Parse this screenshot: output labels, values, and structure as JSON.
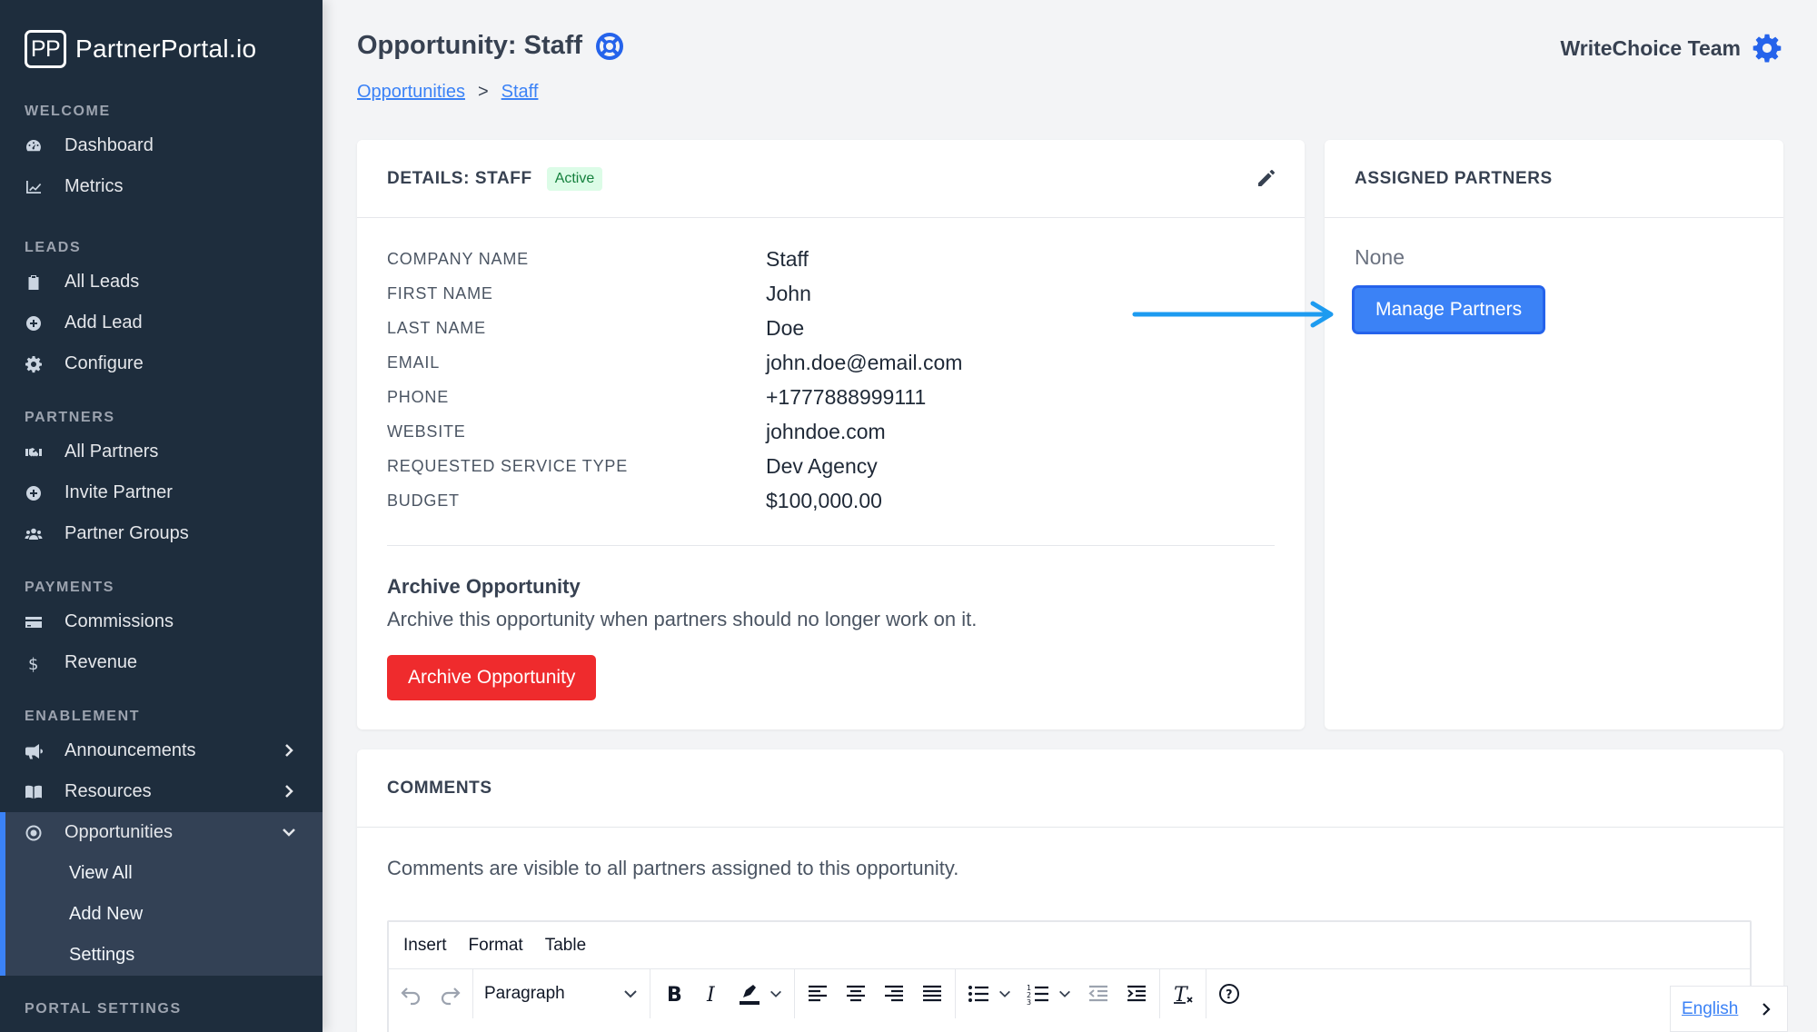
{
  "brand": {
    "logo_text": "PP",
    "name": "PartnerPortal.io"
  },
  "sidebar": {
    "sections": [
      {
        "label": "WELCOME",
        "items": [
          {
            "label": "Dashboard",
            "icon": "dashboard-icon"
          },
          {
            "label": "Metrics",
            "icon": "chart-line-icon"
          }
        ]
      },
      {
        "label": "LEADS",
        "items": [
          {
            "label": "All Leads",
            "icon": "clipboard-icon"
          },
          {
            "label": "Add Lead",
            "icon": "plus-circle-icon"
          },
          {
            "label": "Configure",
            "icon": "gear-icon"
          }
        ]
      },
      {
        "label": "PARTNERS",
        "items": [
          {
            "label": "All Partners",
            "icon": "handshake-icon"
          },
          {
            "label": "Invite Partner",
            "icon": "plus-circle-icon"
          },
          {
            "label": "Partner Groups",
            "icon": "users-icon"
          }
        ]
      },
      {
        "label": "PAYMENTS",
        "items": [
          {
            "label": "Commissions",
            "icon": "credit-card-icon"
          },
          {
            "label": "Revenue",
            "icon": "dollar-icon"
          }
        ]
      },
      {
        "label": "ENABLEMENT",
        "items": [
          {
            "label": "Announcements",
            "icon": "megaphone-icon"
          },
          {
            "label": "Resources",
            "icon": "book-icon"
          }
        ]
      }
    ],
    "active_group": {
      "label": "Opportunities",
      "icon": "target-icon",
      "subitems": [
        "View All",
        "Add New",
        "Settings"
      ]
    },
    "next_section": "PORTAL SETTINGS"
  },
  "header": {
    "title": "Opportunity: Staff",
    "breadcrumb": [
      "Opportunities",
      "Staff"
    ],
    "breadcrumb_sep": ">",
    "team": "WriteChoice Team"
  },
  "details": {
    "title": "DETAILS: STAFF",
    "status": "Active",
    "rows": [
      {
        "label": "COMPANY NAME",
        "value": "Staff"
      },
      {
        "label": "FIRST NAME",
        "value": "John"
      },
      {
        "label": "LAST NAME",
        "value": "Doe"
      },
      {
        "label": "EMAIL",
        "value": "john.doe@email.com"
      },
      {
        "label": "PHONE",
        "value": "+1777888999111"
      },
      {
        "label": "WEBSITE",
        "value": "johndoe.com"
      },
      {
        "label": "REQUESTED SERVICE TYPE",
        "value": "Dev Agency"
      },
      {
        "label": "BUDGET",
        "value": "$100,000.00"
      }
    ],
    "archive_title": "Archive Opportunity",
    "archive_desc": "Archive this opportunity when partners should no longer work on it.",
    "archive_button": "Archive Opportunity"
  },
  "partners": {
    "title": "ASSIGNED PARTNERS",
    "none": "None",
    "manage_button": "Manage Partners"
  },
  "comments": {
    "title": "COMMENTS",
    "desc": "Comments are visible to all partners assigned to this opportunity.",
    "menu": [
      "Insert",
      "Format",
      "Table"
    ],
    "block_format": "Paragraph"
  },
  "language": "English",
  "colors": {
    "sidebar": "#1e2d3d",
    "accent": "#3b82f6",
    "danger": "#ef2b2d",
    "success_bg": "#dcfce7"
  }
}
